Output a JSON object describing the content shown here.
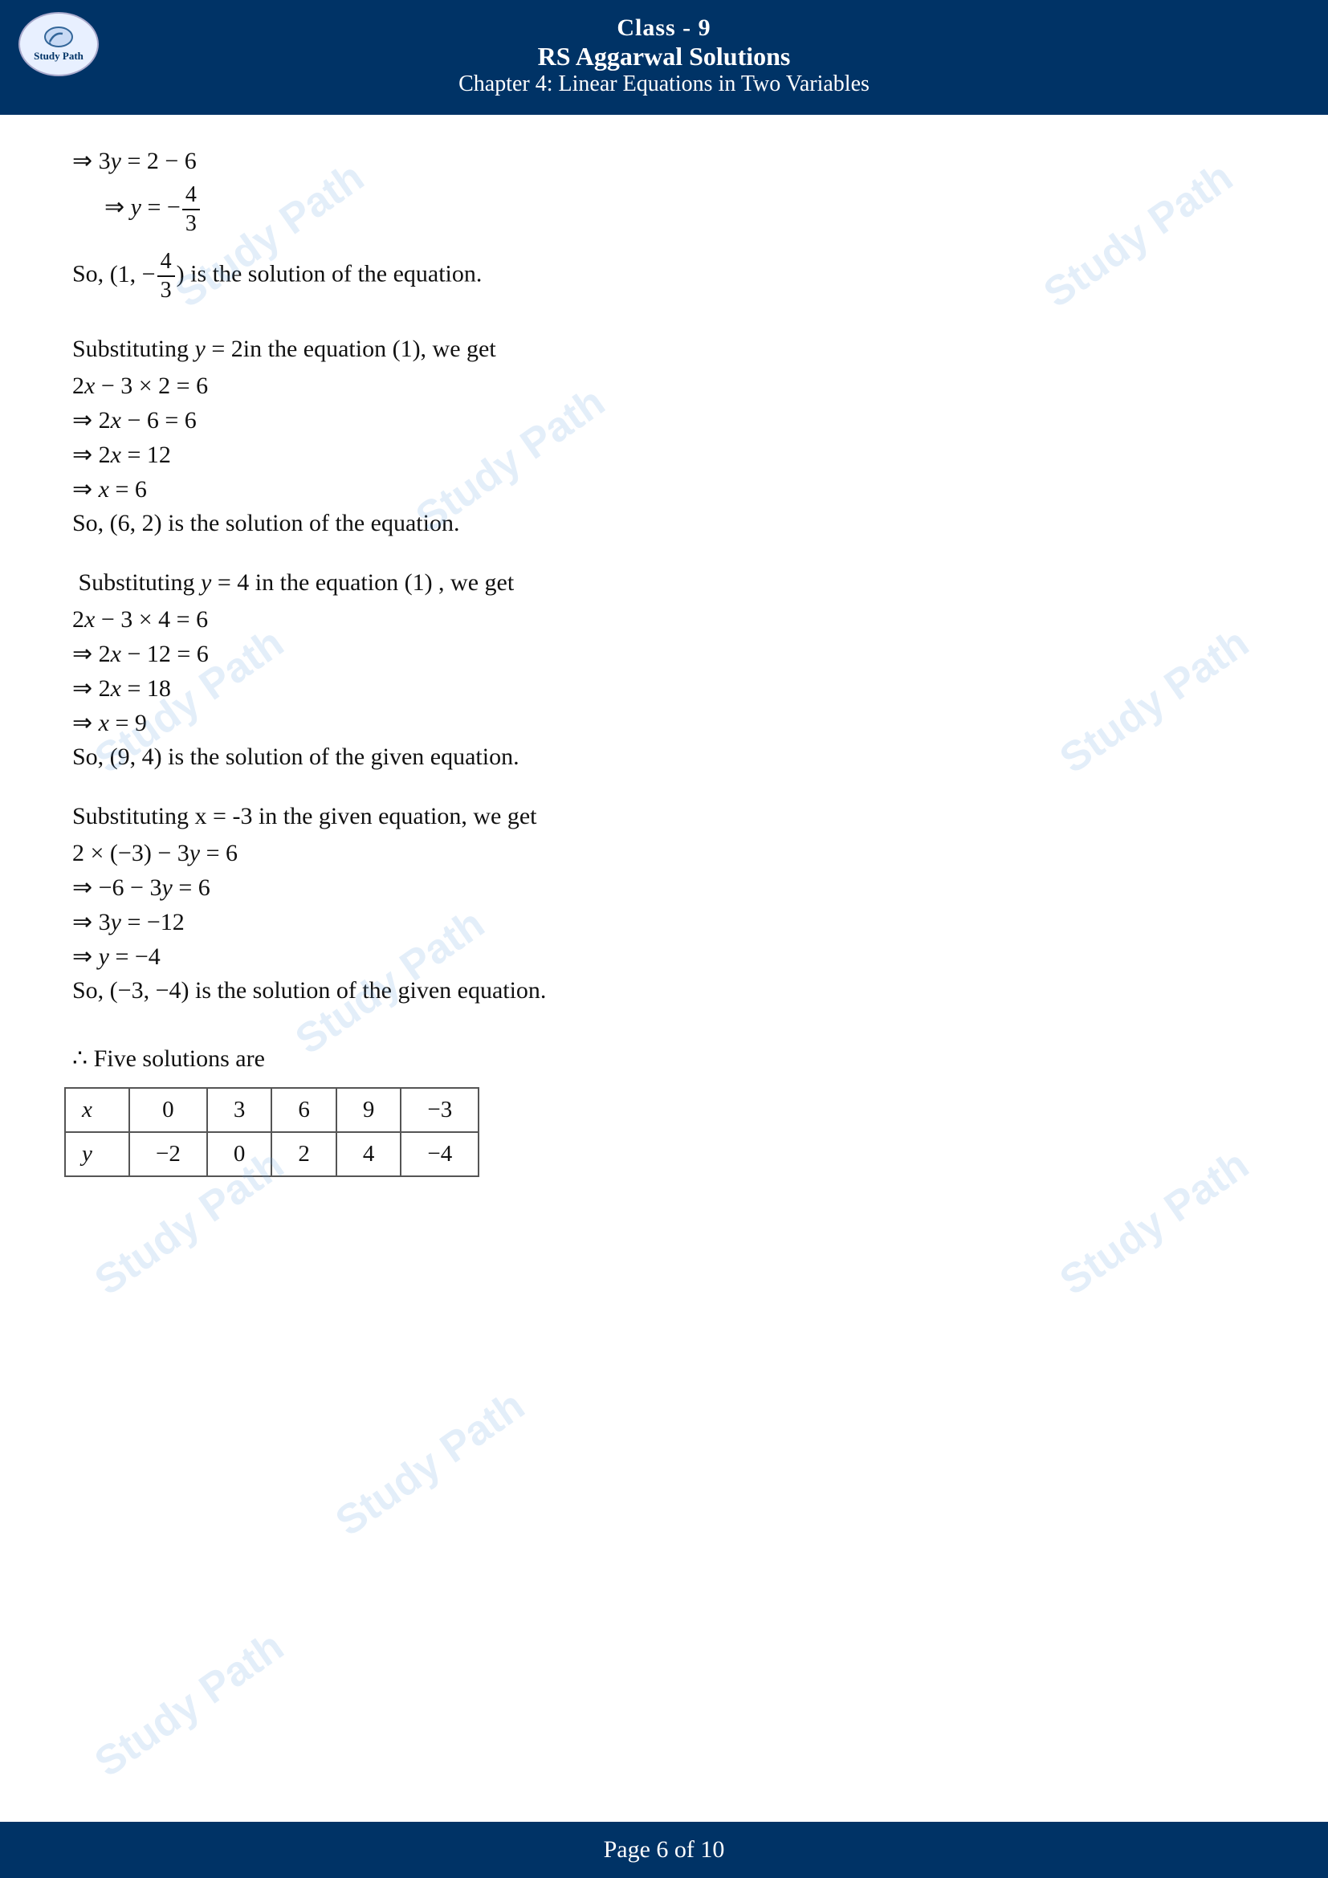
{
  "header": {
    "class_line": "Class - 9",
    "rs_line": "RS Aggarwal Solutions",
    "chapter_line": "Chapter 4: Linear Equations in Two Variables"
  },
  "logo": {
    "line1": "Study",
    "line2": "Path"
  },
  "content": {
    "section1": {
      "line1": "⇒ 3y = 2 − 6",
      "line2_pre": "⇒ y = −",
      "line2_frac_num": "4",
      "line2_frac_den": "3",
      "line3_pre": "So,",
      "line3_point": "(1, −",
      "line3_frac_num": "4",
      "line3_frac_den": "3",
      "line3_post": ") is the solution of the equation."
    },
    "section2": {
      "intro": "Substituting y = 2in the equation (1), we get",
      "line1": "2x − 3 × 2 = 6",
      "line2": "⇒ 2x − 6 = 6",
      "line3": "⇒ 2x = 12",
      "line4": "⇒ x = 6",
      "conclusion": "So, (6, 2) is the solution of the equation."
    },
    "section3": {
      "intro": "Substituting y = 4 in the equation (1) , we get",
      "line1": "2x − 3 × 4 = 6",
      "line2": "⇒ 2x − 12 = 6",
      "line3": "⇒ 2x = 18",
      "line4": "⇒ x = 9",
      "conclusion": "So, (9, 4) is the solution of the given equation."
    },
    "section4": {
      "intro": "Substituting x = -3 in the given equation, we get",
      "line1": "2 × (−3) − 3y = 6",
      "line2": "⇒ −6 − 3y = 6",
      "line3": "⇒ 3y = −12",
      "line4": "⇒ y = −4",
      "conclusion": "So, (−3, −4) is the solution of the given equation."
    },
    "section5": {
      "intro": "∴ Five solutions are",
      "table": {
        "headers": [
          "x",
          "0",
          "3",
          "6",
          "9",
          "−3"
        ],
        "row2": [
          "y",
          "−2",
          "0",
          "2",
          "4",
          "−4"
        ]
      }
    }
  },
  "footer": {
    "text": "Page 6 of 10"
  },
  "watermarks": [
    "Study Path",
    "Study Path",
    "Study Path",
    "Study Path",
    "Study Path",
    "Study Path",
    "Study Path",
    "Study Path"
  ]
}
